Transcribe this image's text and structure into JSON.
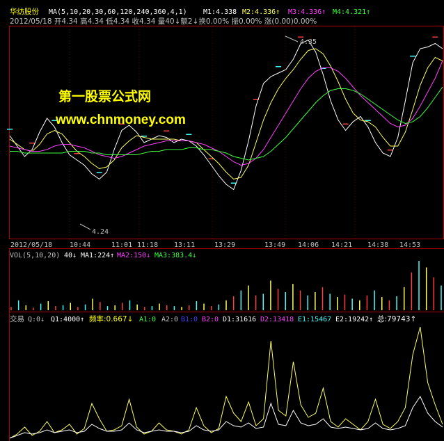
{
  "header": {
    "stock_name": "华纺股份",
    "ma_params": "MA(5,10,20,30,60,120,240,360,4,1)",
    "m1": "M1:4.338",
    "m2": "M2:4.336↑",
    "m3": "M3:4.336↑",
    "m4": "M4:4.321↑",
    "info_line": "2012/05/18 开4.34 高4.34 低4.34 收4.34 量40↓额2↓换0.00% 振0.00% 涨(0.00)0.00%"
  },
  "watermark": {
    "line1": "第一股票公式网",
    "line2": "www.chnmoney.com"
  },
  "price_panel": {
    "high_label": "4.35",
    "low_label": "4.24"
  },
  "time_axis": {
    "date": "2012/05/18",
    "ticks": [
      "10:44",
      "11:01",
      "11:18",
      "13:11",
      "13:29",
      "13:49",
      "14:06",
      "14:21",
      "14:38",
      "14:53"
    ]
  },
  "volume_panel": {
    "params": "VOL(5,10,20)",
    "value": "40↓",
    "ma1": "MA1:224↑",
    "ma2": "MA2:150↓",
    "ma3": "MA3:383.4↓"
  },
  "trade_panel": {
    "title": "交易",
    "q": "Q:0↓",
    "q1": "Q1:4000↑",
    "rate": "频率:0.667↓",
    "a1": "A1:0",
    "a2": "A2:0",
    "b1": "B1:0",
    "b2": "B2:0",
    "d1": "D1:31616",
    "d2": "D2:13418",
    "e1": "E1:15467",
    "e2": "E2:19242↑",
    "total": "总:79743↑"
  },
  "colors": {
    "frame": "#b00000",
    "price_line": "#ffffff",
    "ma1": "#ffff60",
    "ma2": "#ff40ff",
    "ma3": "#40ff40",
    "up": "#ff4040",
    "down": "#40ffff",
    "axis_text": "#c0c0c0",
    "watermark": "#ffff00"
  },
  "chart_data": [
    {
      "type": "line",
      "title": "华纺股份",
      "ylim": [
        4.235,
        4.355
      ],
      "series": [
        {
          "name": "M1",
          "values": [
            4.293,
            4.287,
            4.281,
            4.285,
            4.295,
            4.303,
            4.298,
            4.289,
            4.282,
            4.279,
            4.276,
            4.271,
            4.268,
            4.272,
            4.285,
            4.296,
            4.299,
            4.295,
            4.289,
            4.291,
            4.293,
            4.292,
            4.289,
            4.291,
            4.29,
            4.287,
            4.282,
            4.276,
            4.27,
            4.265,
            4.262,
            4.273,
            4.29,
            4.31,
            4.323,
            4.327,
            4.329,
            4.331,
            4.337,
            4.346,
            4.348,
            4.341,
            4.328,
            4.313,
            4.302,
            4.296,
            4.301,
            4.304,
            4.298,
            4.289,
            4.283,
            4.281,
            4.292,
            4.313,
            4.335,
            4.343,
            4.344,
            4.346,
            4.343
          ]
        },
        {
          "name": "M2",
          "values": [
            4.291,
            4.288,
            4.285,
            4.284,
            4.288,
            4.294,
            4.296,
            4.294,
            4.289,
            4.284,
            4.281,
            4.277,
            4.274,
            4.275,
            4.279,
            4.286,
            4.29,
            4.293,
            4.292,
            4.291,
            4.291,
            4.291,
            4.291,
            4.29,
            4.29,
            4.289,
            4.285,
            4.281,
            4.277,
            4.272,
            4.268,
            4.269,
            4.276,
            4.289,
            4.302,
            4.312,
            4.32,
            4.326,
            4.331,
            4.337,
            4.342,
            4.343,
            4.34,
            4.333,
            4.324,
            4.314,
            4.306,
            4.302,
            4.301,
            4.298,
            4.292,
            4.287,
            4.287,
            4.295,
            4.308,
            4.322,
            4.332,
            4.338,
            4.336
          ]
        },
        {
          "name": "M3",
          "values": [
            4.287,
            4.286,
            4.285,
            4.284,
            4.284,
            4.285,
            4.287,
            4.288,
            4.288,
            4.287,
            4.286,
            4.284,
            4.282,
            4.281,
            4.28,
            4.281,
            4.283,
            4.285,
            4.287,
            4.288,
            4.289,
            4.29,
            4.29,
            4.29,
            4.29,
            4.289,
            4.288,
            4.286,
            4.284,
            4.281,
            4.278,
            4.276,
            4.277,
            4.28,
            4.285,
            4.292,
            4.299,
            4.306,
            4.313,
            4.32,
            4.326,
            4.33,
            4.332,
            4.332,
            4.33,
            4.326,
            4.321,
            4.316,
            4.312,
            4.308,
            4.304,
            4.3,
            4.298,
            4.299,
            4.303,
            4.31,
            4.318,
            4.326,
            4.336
          ]
        },
        {
          "name": "M4",
          "values": [
            4.284,
            4.284,
            4.283,
            4.283,
            4.283,
            4.283,
            4.283,
            4.283,
            4.284,
            4.284,
            4.284,
            4.283,
            4.283,
            4.282,
            4.282,
            4.282,
            4.282,
            4.282,
            4.283,
            4.284,
            4.284,
            4.285,
            4.285,
            4.285,
            4.286,
            4.286,
            4.285,
            4.285,
            4.284,
            4.283,
            4.281,
            4.28,
            4.279,
            4.28,
            4.281,
            4.284,
            4.288,
            4.292,
            4.297,
            4.302,
            4.307,
            4.312,
            4.316,
            4.319,
            4.32,
            4.32,
            4.319,
            4.317,
            4.314,
            4.311,
            4.308,
            4.305,
            4.302,
            4.3,
            4.301,
            4.304,
            4.309,
            4.315,
            4.321
          ]
        }
      ]
    },
    {
      "type": "bar",
      "title": "VOL(5,10,20)",
      "values": [
        20,
        60,
        30,
        15,
        40,
        55,
        25,
        30,
        45,
        20,
        35,
        70,
        50,
        25,
        30,
        45,
        60,
        35,
        20,
        25,
        40,
        30,
        25,
        20,
        30,
        55,
        40,
        25,
        35,
        60,
        85,
        120,
        150,
        90,
        100,
        180,
        130,
        110,
        160,
        120,
        90,
        110,
        140,
        100,
        80,
        95,
        70,
        60,
        90,
        120,
        80,
        60,
        85,
        140,
        230,
        300,
        260,
        200,
        150
      ]
    },
    {
      "type": "line",
      "title": "交易",
      "series": [
        {
          "name": "Q",
          "values": [
            0,
            3,
            8,
            2,
            5,
            12,
            4,
            6,
            10,
            3,
            7,
            25,
            14,
            5,
            6,
            9,
            28,
            8,
            3,
            5,
            11,
            6,
            5,
            3,
            6,
            22,
            9,
            4,
            7,
            30,
            18,
            12,
            26,
            9,
            14,
            70,
            20,
            16,
            55,
            24,
            15,
            18,
            36,
            12,
            8,
            14,
            10,
            6,
            12,
            28,
            10,
            7,
            12,
            22,
            60,
            80,
            40,
            24,
            10
          ]
        },
        {
          "name": "Q1",
          "values": [
            0,
            2,
            4,
            3,
            4,
            6,
            4,
            5,
            6,
            4,
            5,
            10,
            7,
            5,
            5,
            6,
            11,
            6,
            4,
            5,
            6,
            5,
            5,
            4,
            5,
            9,
            6,
            5,
            6,
            12,
            9,
            8,
            11,
            7,
            8,
            25,
            10,
            9,
            20,
            11,
            9,
            10,
            14,
            8,
            7,
            8,
            7,
            6,
            7,
            11,
            7,
            6,
            7,
            9,
            22,
            30,
            18,
            12,
            8
          ]
        }
      ]
    }
  ]
}
